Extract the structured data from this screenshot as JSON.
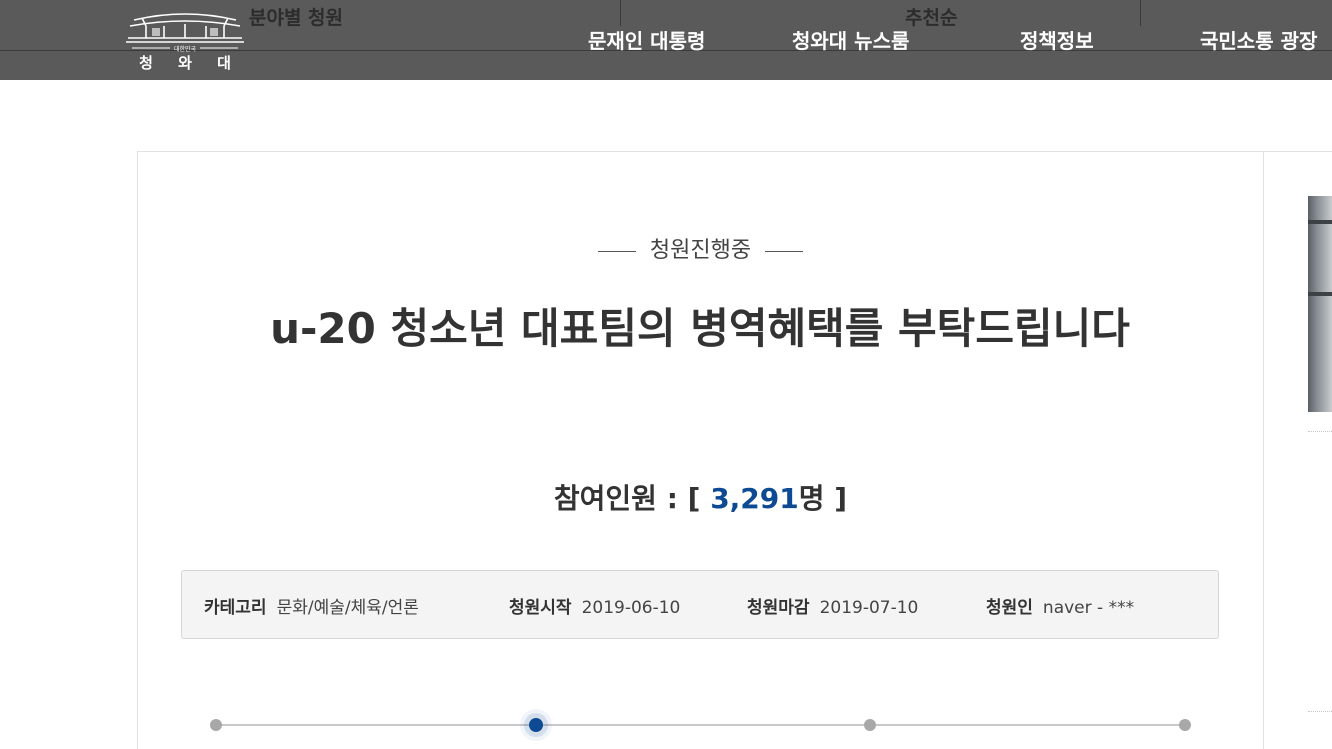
{
  "header": {
    "logo": {
      "small_text": "대한민국",
      "name": "청 와 대"
    },
    "behind": {
      "category_label": "분야별 청원",
      "sort_label": "추천순"
    },
    "nav": [
      {
        "label": "문재인 대통령"
      },
      {
        "label": "청와대 뉴스룸"
      },
      {
        "label": "정책정보"
      },
      {
        "label": "국민소통 광장"
      }
    ]
  },
  "petition": {
    "status": "청원진행중",
    "title": "u-20 청소년 대표팀의 병역혜택를 부탁드립니다",
    "count_label": "참여인원 : [",
    "count_value": "3,291",
    "count_unit": "명",
    "count_close": " ]",
    "info": {
      "category_label": "카테고리",
      "category_value": "문화/예술/체육/언론",
      "start_label": "청원시작",
      "start_value": "2019-06-10",
      "end_label": "청원마감",
      "end_value": "2019-07-10",
      "author_label": "청원인",
      "author_value": "naver - ***"
    },
    "progress": {
      "steps": 4,
      "active_step": 2
    }
  },
  "colors": {
    "header_bg": "#5a5a5a",
    "accent": "#0e4a94",
    "info_bg": "#f4f4f4"
  }
}
